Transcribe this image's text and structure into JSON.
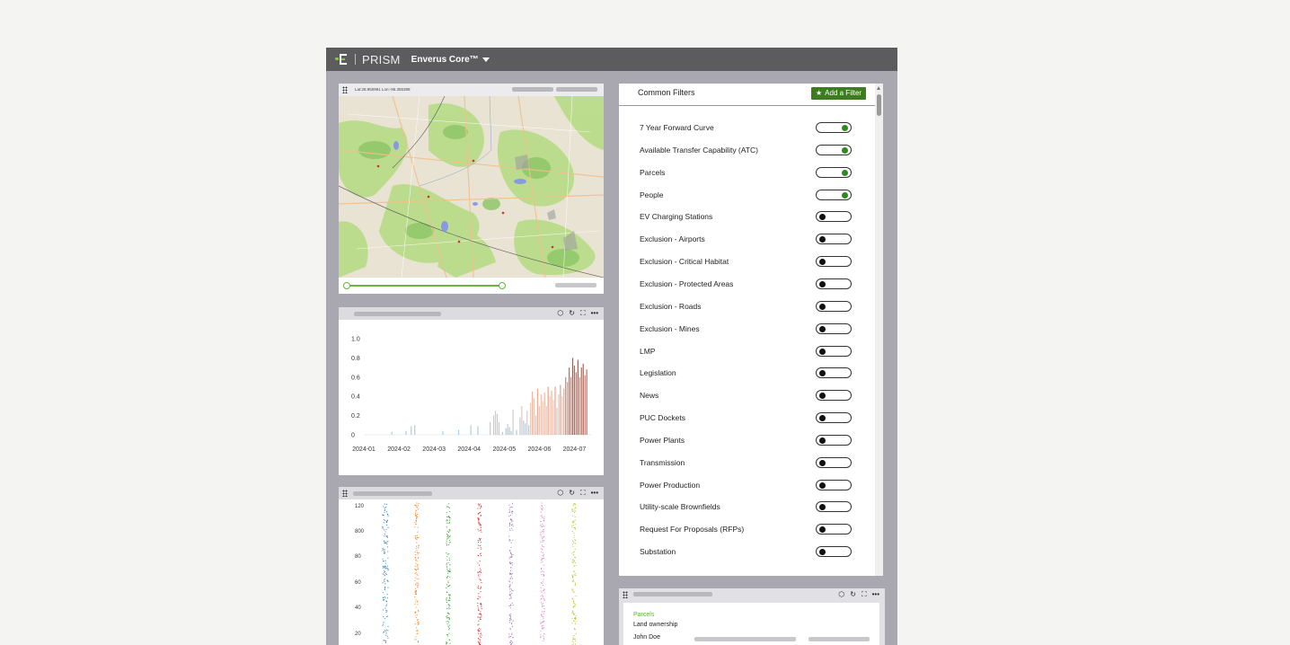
{
  "header": {
    "brand": "PRISM",
    "product": "Enverus Core™"
  },
  "map": {
    "coords": "Lat:28.950991 Lon:-95.355398"
  },
  "filters": {
    "title": "Common Filters",
    "add_label": "Add a Filter",
    "items": [
      {
        "label": "7 Year Forward Curve",
        "on": true
      },
      {
        "label": "Available Transfer Capability (ATC)",
        "on": true
      },
      {
        "label": "Parcels",
        "on": true
      },
      {
        "label": "People",
        "on": true
      },
      {
        "label": "EV Charging Stations",
        "on": false
      },
      {
        "label": "Exclusion - Airports",
        "on": false
      },
      {
        "label": "Exclusion - Critical Habitat",
        "on": false
      },
      {
        "label": "Exclusion - Protected Areas",
        "on": false
      },
      {
        "label": "Exclusion - Roads",
        "on": false
      },
      {
        "label": "Exclusion - Mines",
        "on": false
      },
      {
        "label": "LMP",
        "on": false
      },
      {
        "label": "Legislation",
        "on": false
      },
      {
        "label": "News",
        "on": false
      },
      {
        "label": "PUC Dockets",
        "on": false
      },
      {
        "label": "Power Plants",
        "on": false
      },
      {
        "label": "Transmission",
        "on": false
      },
      {
        "label": "Power Production",
        "on": false
      },
      {
        "label": "Utility-scale Brownfields",
        "on": false
      },
      {
        "label": "Request For Proposals (RFPs)",
        "on": false
      },
      {
        "label": "Substation",
        "on": false
      }
    ]
  },
  "card": {
    "tag": "Parcels",
    "subtitle": "Land ownership",
    "owner": "John Doe"
  },
  "colors": {
    "accent": "#3d7d1f",
    "toggle_on": "#2f8a1d",
    "slider": "#6cb33f",
    "topbar": "#5c5c5e",
    "map_green": "#b9dc8a",
    "bar_low": "#a9cde3",
    "bar_high": "#e0462b"
  },
  "chart_data": [
    {
      "type": "bar",
      "x_ticks": [
        "2024-01",
        "2024-02",
        "2024-03",
        "2024-04",
        "2024-05",
        "2024-06",
        "2024-07"
      ],
      "y_ticks": [
        "0",
        "0.2",
        "0.4",
        "0.6",
        "0.8",
        "1.0"
      ],
      "ylim": [
        0,
        1.0
      ],
      "xlim": [
        0,
        6.5
      ],
      "color_scale": "light blue (low) to red (high)",
      "points": [
        [
          0.8,
          0.03
        ],
        [
          1.2,
          0.04
        ],
        [
          1.35,
          0.09
        ],
        [
          1.45,
          0.1
        ],
        [
          2.25,
          0.04
        ],
        [
          2.7,
          0.05
        ],
        [
          3.05,
          0.1
        ],
        [
          3.25,
          0.09
        ],
        [
          3.6,
          0.13
        ],
        [
          3.7,
          0.2
        ],
        [
          3.75,
          0.25
        ],
        [
          3.8,
          0.22
        ],
        [
          3.85,
          0.13
        ],
        [
          3.95,
          0.03
        ],
        [
          4.05,
          0.07
        ],
        [
          4.1,
          0.11
        ],
        [
          4.15,
          0.08
        ],
        [
          4.2,
          0.04
        ],
        [
          4.25,
          0.26
        ],
        [
          4.35,
          0.05
        ],
        [
          4.45,
          0.18
        ],
        [
          4.5,
          0.3
        ],
        [
          4.55,
          0.15
        ],
        [
          4.6,
          0.12
        ],
        [
          4.65,
          0.25
        ],
        [
          4.7,
          0.1
        ],
        [
          4.75,
          0.33
        ],
        [
          4.8,
          0.45
        ],
        [
          4.85,
          0.38
        ],
        [
          4.9,
          0.2
        ],
        [
          4.95,
          0.48
        ],
        [
          5.0,
          0.3
        ],
        [
          5.05,
          0.42
        ],
        [
          5.1,
          0.35
        ],
        [
          5.15,
          0.44
        ],
        [
          5.2,
          0.3
        ],
        [
          5.25,
          0.5
        ],
        [
          5.3,
          0.4
        ],
        [
          5.35,
          0.46
        ],
        [
          5.4,
          0.36
        ],
        [
          5.45,
          0.5
        ],
        [
          5.5,
          0.28
        ],
        [
          5.55,
          0.42
        ],
        [
          5.6,
          0.52
        ],
        [
          5.65,
          0.4
        ],
        [
          5.7,
          0.48
        ],
        [
          5.75,
          0.6
        ],
        [
          5.8,
          0.55
        ],
        [
          5.85,
          0.7
        ],
        [
          5.9,
          0.6
        ],
        [
          5.95,
          0.8
        ],
        [
          6.0,
          0.72
        ],
        [
          6.05,
          0.65
        ],
        [
          6.1,
          0.78
        ],
        [
          6.15,
          0.6
        ],
        [
          6.2,
          0.7
        ],
        [
          6.25,
          0.74
        ],
        [
          6.3,
          0.62
        ],
        [
          6.35,
          0.68
        ]
      ]
    },
    {
      "type": "scatter",
      "y_ticks": [
        "20",
        "40",
        "60",
        "80",
        "800",
        "120"
      ],
      "series": [
        {
          "color": "#1f77b4"
        },
        {
          "color": "#ff7f0e"
        },
        {
          "color": "#2ca02c"
        },
        {
          "color": "#d62728"
        },
        {
          "color": "#9467bd"
        },
        {
          "color": "#e377c2"
        },
        {
          "color": "#bcbd22"
        }
      ]
    }
  ]
}
